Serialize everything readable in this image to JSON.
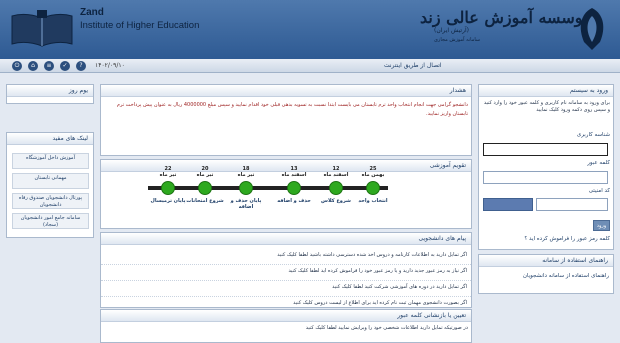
{
  "header": {
    "brand_en": "Zand",
    "institute_en": "Institute of Higher Education",
    "brand_fa": "موسسه آموزش عالی زند",
    "subtitle": "(آرتیش ایران)",
    "subtitle2": "سامانه آموزش مجازی"
  },
  "toolbar": {
    "date": "۱۴۰۲/۰۹/۱۰",
    "nav_link": "اتصال از طریق اینترنت",
    "icons": [
      "power-icon",
      "home-icon",
      "document-icon",
      "check-icon",
      "help-icon",
      "info-icon"
    ]
  },
  "left": {
    "today_title": "یوم روز",
    "links_title": "لینک های مفید",
    "links": [
      "آموزش داخل آموزشگاه",
      "مهمانی تابستان",
      "پورتال دانشجویان صندوق رفاه دانشجویان",
      "سامانه جامع امور دانشجویان (سجاد)"
    ]
  },
  "news": {
    "title": "هشدار",
    "text": "دانشجو گرامی جهت انجام انتخاب واحد ترم تابستان می بایست ابتدا نسبت به تسویه بدهی قبلی خود اقدام نمایید و سپس مبلغ 4000000 ریال به عنوان پیش پرداخت ترم تابستان واریز نمایید."
  },
  "calendar": {
    "title": "تقویم آموزشی",
    "events": [
      {
        "day": "25",
        "month": "بهمن ماه",
        "label": "انتخاب واحد"
      },
      {
        "day": "12",
        "month": "اسفند ماه",
        "label": "شروع کلاس"
      },
      {
        "day": "13",
        "month": "اسفند ماه",
        "label": "حذف و اضافه"
      },
      {
        "day": "18",
        "month": "تیر ماه",
        "label": "پایان حذف و اضافه"
      },
      {
        "day": "20",
        "month": "تیر ماه",
        "label": "شروع امتحانات"
      },
      {
        "day": "22",
        "month": "تیر ماه",
        "label": "پایان ترمیسال"
      }
    ]
  },
  "student_news": {
    "title": "پیام های دانشجویی",
    "items": [
      "اگر تمایل دارید به اطلاعات کارنامه و دروس اخذ شده دسترسی داشته باشید لطفا کلیک کنید",
      "اگر نیاز به رمز عبور جدید دارید و یا رمز عبور خود را فراموش کرده اید لطفا کلیک کنید",
      "اگر تمایل دارید در دوره های آموزشی شرکت کنید لطفا کلیک کنید",
      "اگر بصورت دانشجوی مهمان ثبت نام کرده اید برای اطلاع از لیست دروس کلیک کنید"
    ]
  },
  "password": {
    "title": "تعیین یا بازنشانی کلمه عبور",
    "text": "در صورتیکه تمایل دارید اطلاعات شخصی خود را ویرایش نمایید لطفا کلیک کنید"
  },
  "login": {
    "title": "ورود به سیستم",
    "intro": "برای ورود به سامانه نام کاربری و کلمه عبور خود را وارد کنید و سپس روی دکمه ورود کلیک نمایید",
    "username_label": "شناسه کاربری",
    "password_label": "کلمه عبور",
    "captcha_label": "کد امنیتی",
    "login_button": "ورود",
    "forgot": "کلمه رمز عبور را فراموش کرده اید ؟"
  },
  "help": {
    "title": "راهنمای استفاده از سامانه",
    "link": "راهنمای استفاده از سامانه دانشجویان"
  }
}
